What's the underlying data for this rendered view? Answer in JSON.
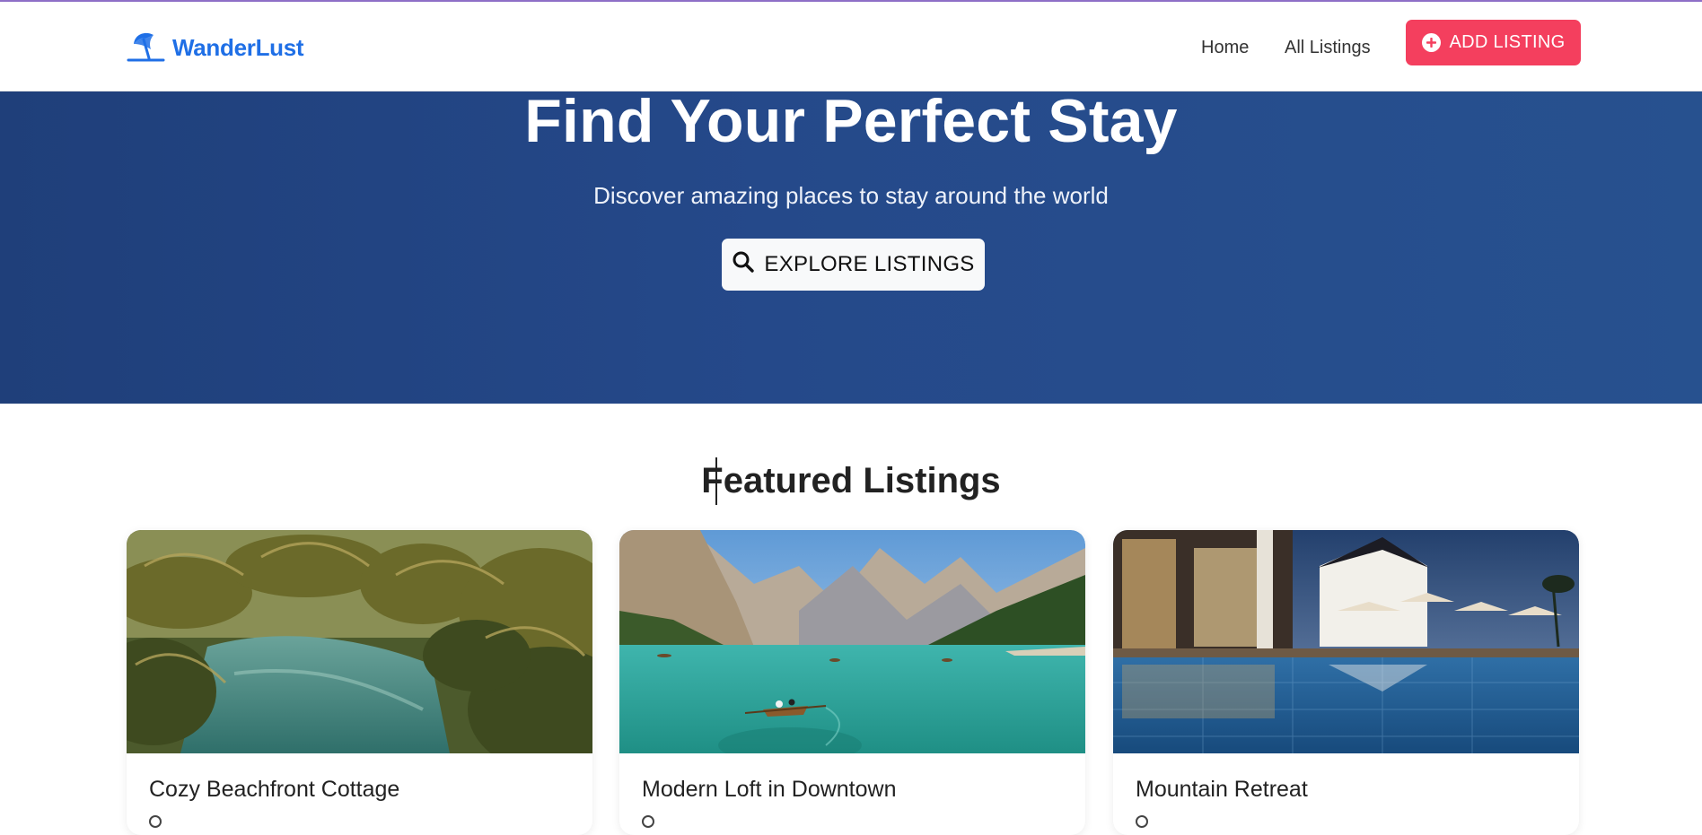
{
  "app": {
    "brand": "WanderLust",
    "brand_icon": "umbrella-beach-icon",
    "brand_color": "#1f6fe6",
    "accent_color": "#f43f5e",
    "hero_color": "#25498a"
  },
  "nav": {
    "home": "Home",
    "all_listings": "All Listings",
    "add_listing": "ADD LISTING"
  },
  "hero": {
    "title": "Find Your Perfect Stay",
    "subtitle": "Discover amazing places to stay around the world",
    "explore_button": "EXPLORE LISTINGS"
  },
  "featured": {
    "heading": "Featured Listings",
    "listings": [
      {
        "title": "Cozy Beachfront Cottage",
        "image": "tropical-lagoon-palms"
      },
      {
        "title": "Modern Loft in Downtown",
        "image": "mountain-lake-boat"
      },
      {
        "title": "Mountain Retreat",
        "image": "resort-pool-night"
      }
    ]
  }
}
